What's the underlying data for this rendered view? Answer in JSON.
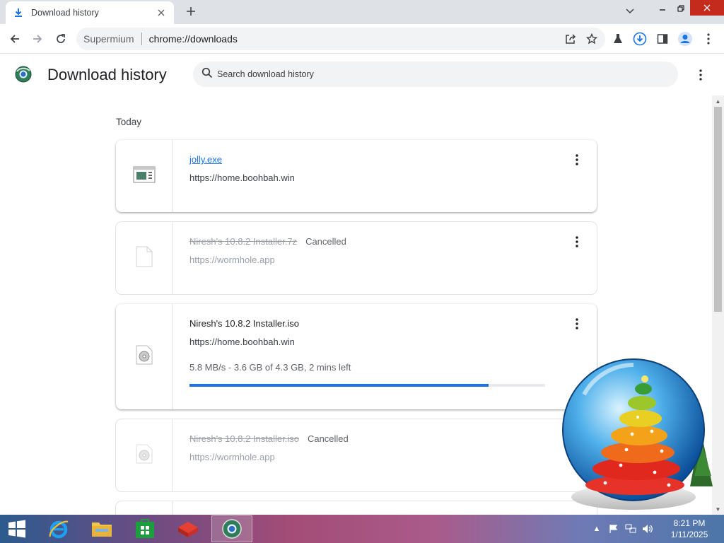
{
  "browser": {
    "tab_title": "Download history",
    "tab_icon": "download-icon",
    "new_tab_icon": "plus-icon",
    "omnibox_chip": "Supermium",
    "url": "chrome://downloads",
    "close_color": "#c42b1c",
    "accent": "#1a73e8"
  },
  "downloads_page": {
    "title": "Download history",
    "search_placeholder": "Search download history",
    "date_group": "Today",
    "items": [
      {
        "filename": "jolly.exe",
        "url": "https://home.boohbah.win",
        "status": "",
        "file_icon": "executable-file-icon"
      },
      {
        "filename": "Niresh's 10.8.2 Installer.7z",
        "url": "https://wormhole.app",
        "status": "Cancelled",
        "file_icon": "blank-file-icon"
      },
      {
        "filename": "Niresh's 10.8.2 Installer.iso",
        "url": "https://home.boohbah.win",
        "status": "",
        "progress_text": "5.8 MB/s - 3.6 GB of 4.3 GB, 2 mins left",
        "progress_fraction": 0.84,
        "file_icon": "disc-image-icon"
      },
      {
        "filename": "Niresh's 10.8.2 Installer.iso",
        "url": "https://wormhole.app",
        "status": "Cancelled",
        "file_icon": "disc-image-icon"
      }
    ]
  },
  "taskbar": {
    "pinned": [
      "start-button",
      "internet-explorer-icon",
      "file-explorer-icon",
      "store-icon",
      "app-red-icon",
      "supermium-browser-icon"
    ],
    "clock_time": "8:21 PM",
    "clock_date": "1/11/2025"
  }
}
